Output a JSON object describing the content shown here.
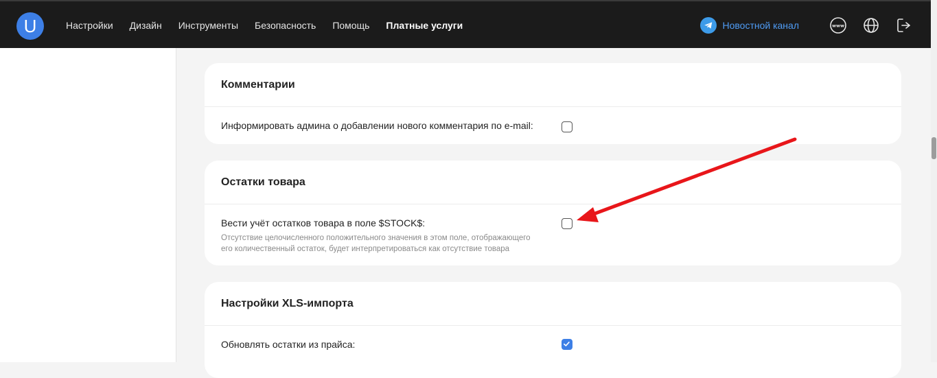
{
  "header": {
    "logo_letter": "U",
    "nav": [
      "Настройки",
      "Дизайн",
      "Инструменты",
      "Безопасность",
      "Помощь",
      "Платные услуги"
    ],
    "news_channel": "Новостной канал",
    "icons": [
      "telegram-icon",
      "www-icon",
      "globe-icon",
      "logout-icon"
    ]
  },
  "sections": {
    "comments": {
      "title": "Комментарии",
      "notify_label": "Информировать админа о добавлении нового комментария по e-mail:",
      "notify_checked": false
    },
    "stock": {
      "title": "Остатки товара",
      "track_label": "Вести учёт остатков товара в поле $STOCK$:",
      "track_hint": "Отсутствие целочисленного положительного значения в этом поле, отображающего его количественный остаток, будет интерпретироваться как отсутствие товара",
      "track_checked": false
    },
    "xls": {
      "title": "Настройки XLS-импорта",
      "update_label": "Обновлять остатки из прайса:",
      "update_checked": true
    }
  },
  "colors": {
    "accent": "#3d7fe6",
    "link": "#4f9cf5",
    "annotation_arrow": "#e8161a",
    "topbar": "#1b1b1b"
  }
}
